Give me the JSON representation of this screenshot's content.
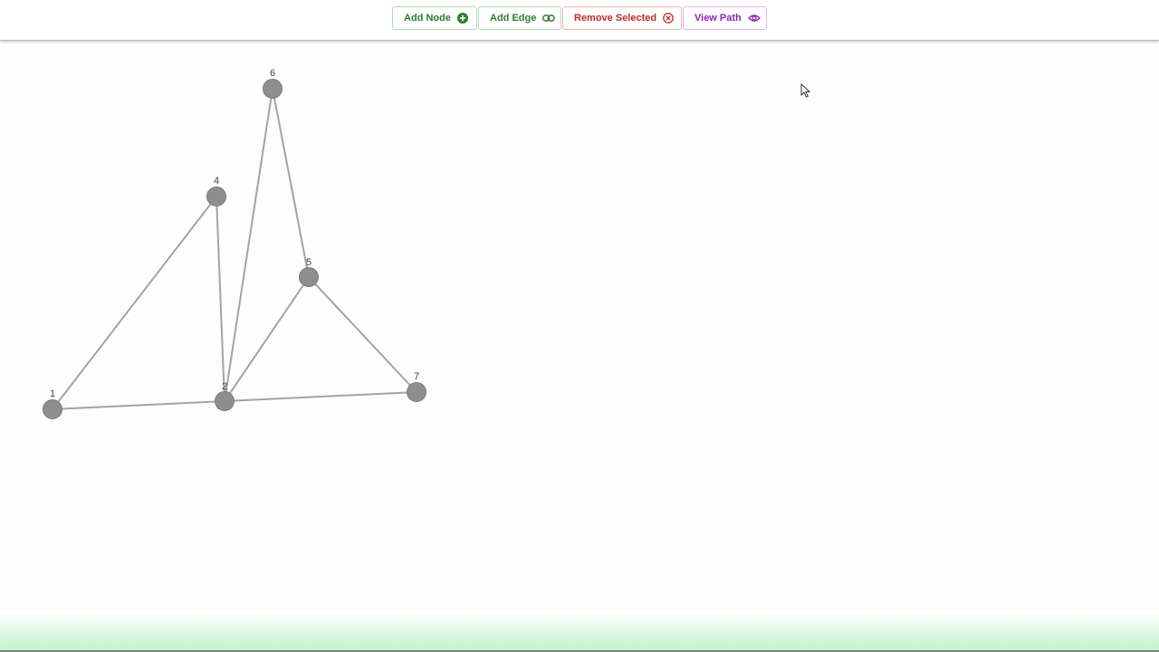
{
  "toolbar": {
    "add_node_label": "Add Node",
    "add_edge_label": "Add Edge",
    "remove_selected_label": "Remove Selected",
    "view_path_label": "View Path"
  },
  "colors": {
    "add": "#2e7d32",
    "remove": "#c62828",
    "view": "#8e24aa",
    "node_fill": "#8e8e8e",
    "edge": "#a3a3a3"
  },
  "icons": {
    "add_node": "plus-circle-icon",
    "add_edge": "link-icon",
    "remove_selected": "x-circle-icon",
    "view_path": "eye-icon",
    "cursor": "mouse-pointer-icon"
  },
  "graph": {
    "nodes": [
      {
        "id": "1",
        "label": "1"
      },
      {
        "id": "2",
        "label": "2"
      },
      {
        "id": "4",
        "label": "4"
      },
      {
        "id": "5",
        "label": "5"
      },
      {
        "id": "6",
        "label": "6"
      },
      {
        "id": "7",
        "label": "7"
      }
    ],
    "edges": [
      {
        "from": "1",
        "to": "2"
      },
      {
        "from": "1",
        "to": "4"
      },
      {
        "from": "4",
        "to": "2"
      },
      {
        "from": "6",
        "to": "2"
      },
      {
        "from": "6",
        "to": "5"
      },
      {
        "from": "5",
        "to": "2"
      },
      {
        "from": "5",
        "to": "7"
      },
      {
        "from": "2",
        "to": "7"
      }
    ]
  }
}
